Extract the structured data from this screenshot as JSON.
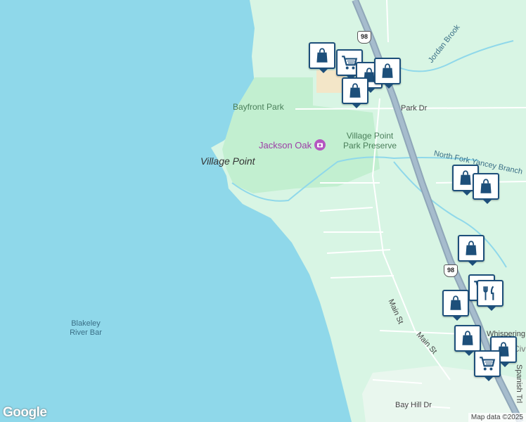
{
  "map": {
    "labels": {
      "village_point": "Village Point",
      "bayfront_park": "Bayfront Park",
      "jackson_oak": "Jackson Oak",
      "village_point_park_preserve": "Village Point Park Preserve",
      "north_fork_yancey_branch": "North Fork Yancey Branch",
      "jordan_brook": "Jordan Brook",
      "blakeley_river_bar": "Blakeley River Bar",
      "park_dr": "Park Dr",
      "main_st_1": "Main St",
      "main_st_2": "Main St",
      "spanish_trl": "Spanish Trl",
      "bay_hill_dr": "Bay Hill Dr",
      "whispering": "Whispering",
      "civ": "Civ"
    },
    "highway_shield": "98",
    "attribution": "Map data ©2025",
    "logo": "Google"
  },
  "markers": [
    {
      "icon": "shopping-bag-icon",
      "category": "shopping"
    },
    {
      "icon": "shopping-cart-icon",
      "category": "grocery"
    },
    {
      "icon": "shopping-bag-icon",
      "category": "shopping"
    },
    {
      "icon": "shopping-bag-icon",
      "category": "shopping"
    },
    {
      "icon": "shopping-bag-icon",
      "category": "shopping"
    },
    {
      "icon": "shopping-bag-icon",
      "category": "shopping"
    },
    {
      "icon": "shopping-bag-icon",
      "category": "shopping"
    },
    {
      "icon": "shopping-bag-icon",
      "category": "shopping"
    },
    {
      "icon": "shopping-cart-icon",
      "category": "grocery"
    },
    {
      "icon": "shopping-bag-icon",
      "category": "shopping"
    },
    {
      "icon": "restaurant-icon",
      "category": "food"
    },
    {
      "icon": "shopping-bag-icon",
      "category": "shopping"
    },
    {
      "icon": "shopping-bag-icon",
      "category": "shopping"
    },
    {
      "icon": "shopping-cart-icon",
      "category": "grocery"
    }
  ],
  "colors": {
    "water": "#8fd8ea",
    "land": "#d8f5e4",
    "park": "#bfeccb",
    "highway": "#8fa6b8",
    "marker_border": "#1d4f7a"
  }
}
